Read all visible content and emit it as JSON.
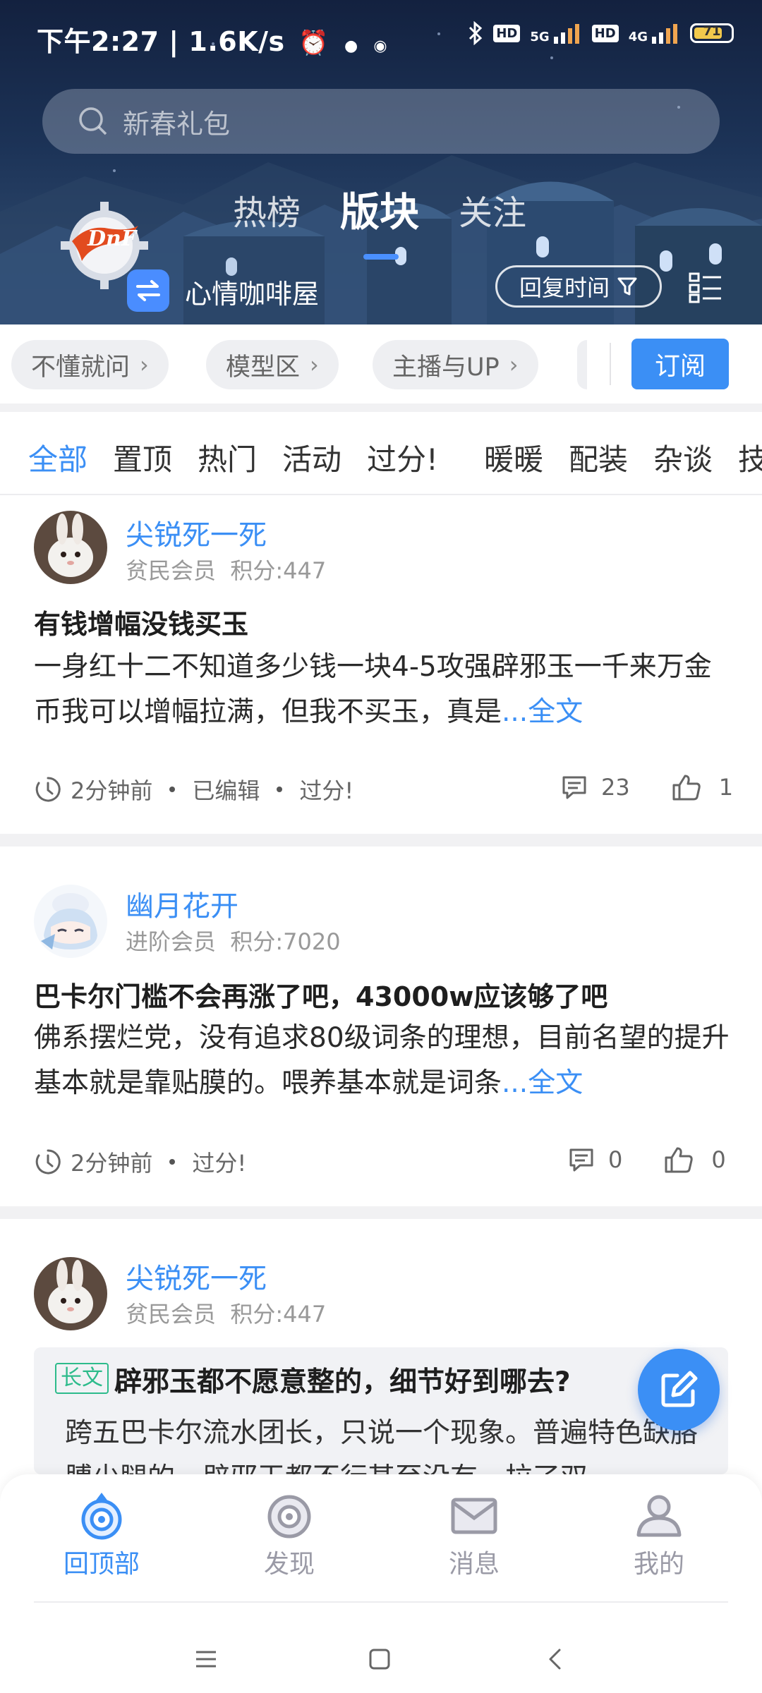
{
  "status_bar": {
    "time": "下午2:27",
    "speed": "1.6K/s",
    "network_1": "5G",
    "network_2": "4G",
    "hd": "HD",
    "battery": "71"
  },
  "search": {
    "placeholder": "新春礼包"
  },
  "nav": {
    "tabs": [
      "热榜",
      "版块",
      "关注"
    ],
    "active_tab": "版块"
  },
  "board": {
    "name": "心情咖啡屋",
    "sort_label": "回复时间"
  },
  "sub_areas": [
    "不懂就问",
    "模型区",
    "主播与UP"
  ],
  "subscribe_label": "订阅",
  "filters": [
    "全部",
    "置顶",
    "热门",
    "活动",
    "过分!",
    "暖暖",
    "配装",
    "杂谈",
    "技"
  ],
  "posts": [
    {
      "author": "尖锐死一死",
      "member_level": "贫民会员",
      "points": "积分:447",
      "title": "有钱增幅没钱买玉",
      "body": " 一身红十二不知道多少钱一块4-5攻强辟邪玉一千来万金币我可以增幅拉满，但我不买玉，真是",
      "more": "...全文",
      "time": "2分钟前",
      "edited": "已编辑",
      "tag": "过分!",
      "comments": "23",
      "likes": "1"
    },
    {
      "author": "幽月花开",
      "member_level": "进阶会员",
      "points": "积分:7020",
      "title": "巴卡尔门槛不会再涨了吧，43000w应该够了吧",
      "body": "佛系摆烂党，没有追求80级词条的理想，目前名望的提升基本就是靠贴膜的。喂养基本就是词条",
      "more": "...全文",
      "time": "2分钟前",
      "tag": "过分!",
      "comments": "0",
      "likes": "0"
    },
    {
      "author": "尖锐死一死",
      "member_level": "贫民会员",
      "points": "积分:447",
      "long_tag": "长文",
      "title": "辟邪玉都不愿意整的，细节好到哪去?",
      "body": "跨五巴卡尔流水团长，只说一个现象。普遍特色缺胳膊少腿的，辟邪玉都不行甚至没有，拉了双"
    }
  ],
  "bottom_nav": [
    "回顶部",
    "发现",
    "消息",
    "我的"
  ],
  "colors": {
    "accent": "#3b8ff5",
    "long_tag": "#2dbb8b"
  }
}
